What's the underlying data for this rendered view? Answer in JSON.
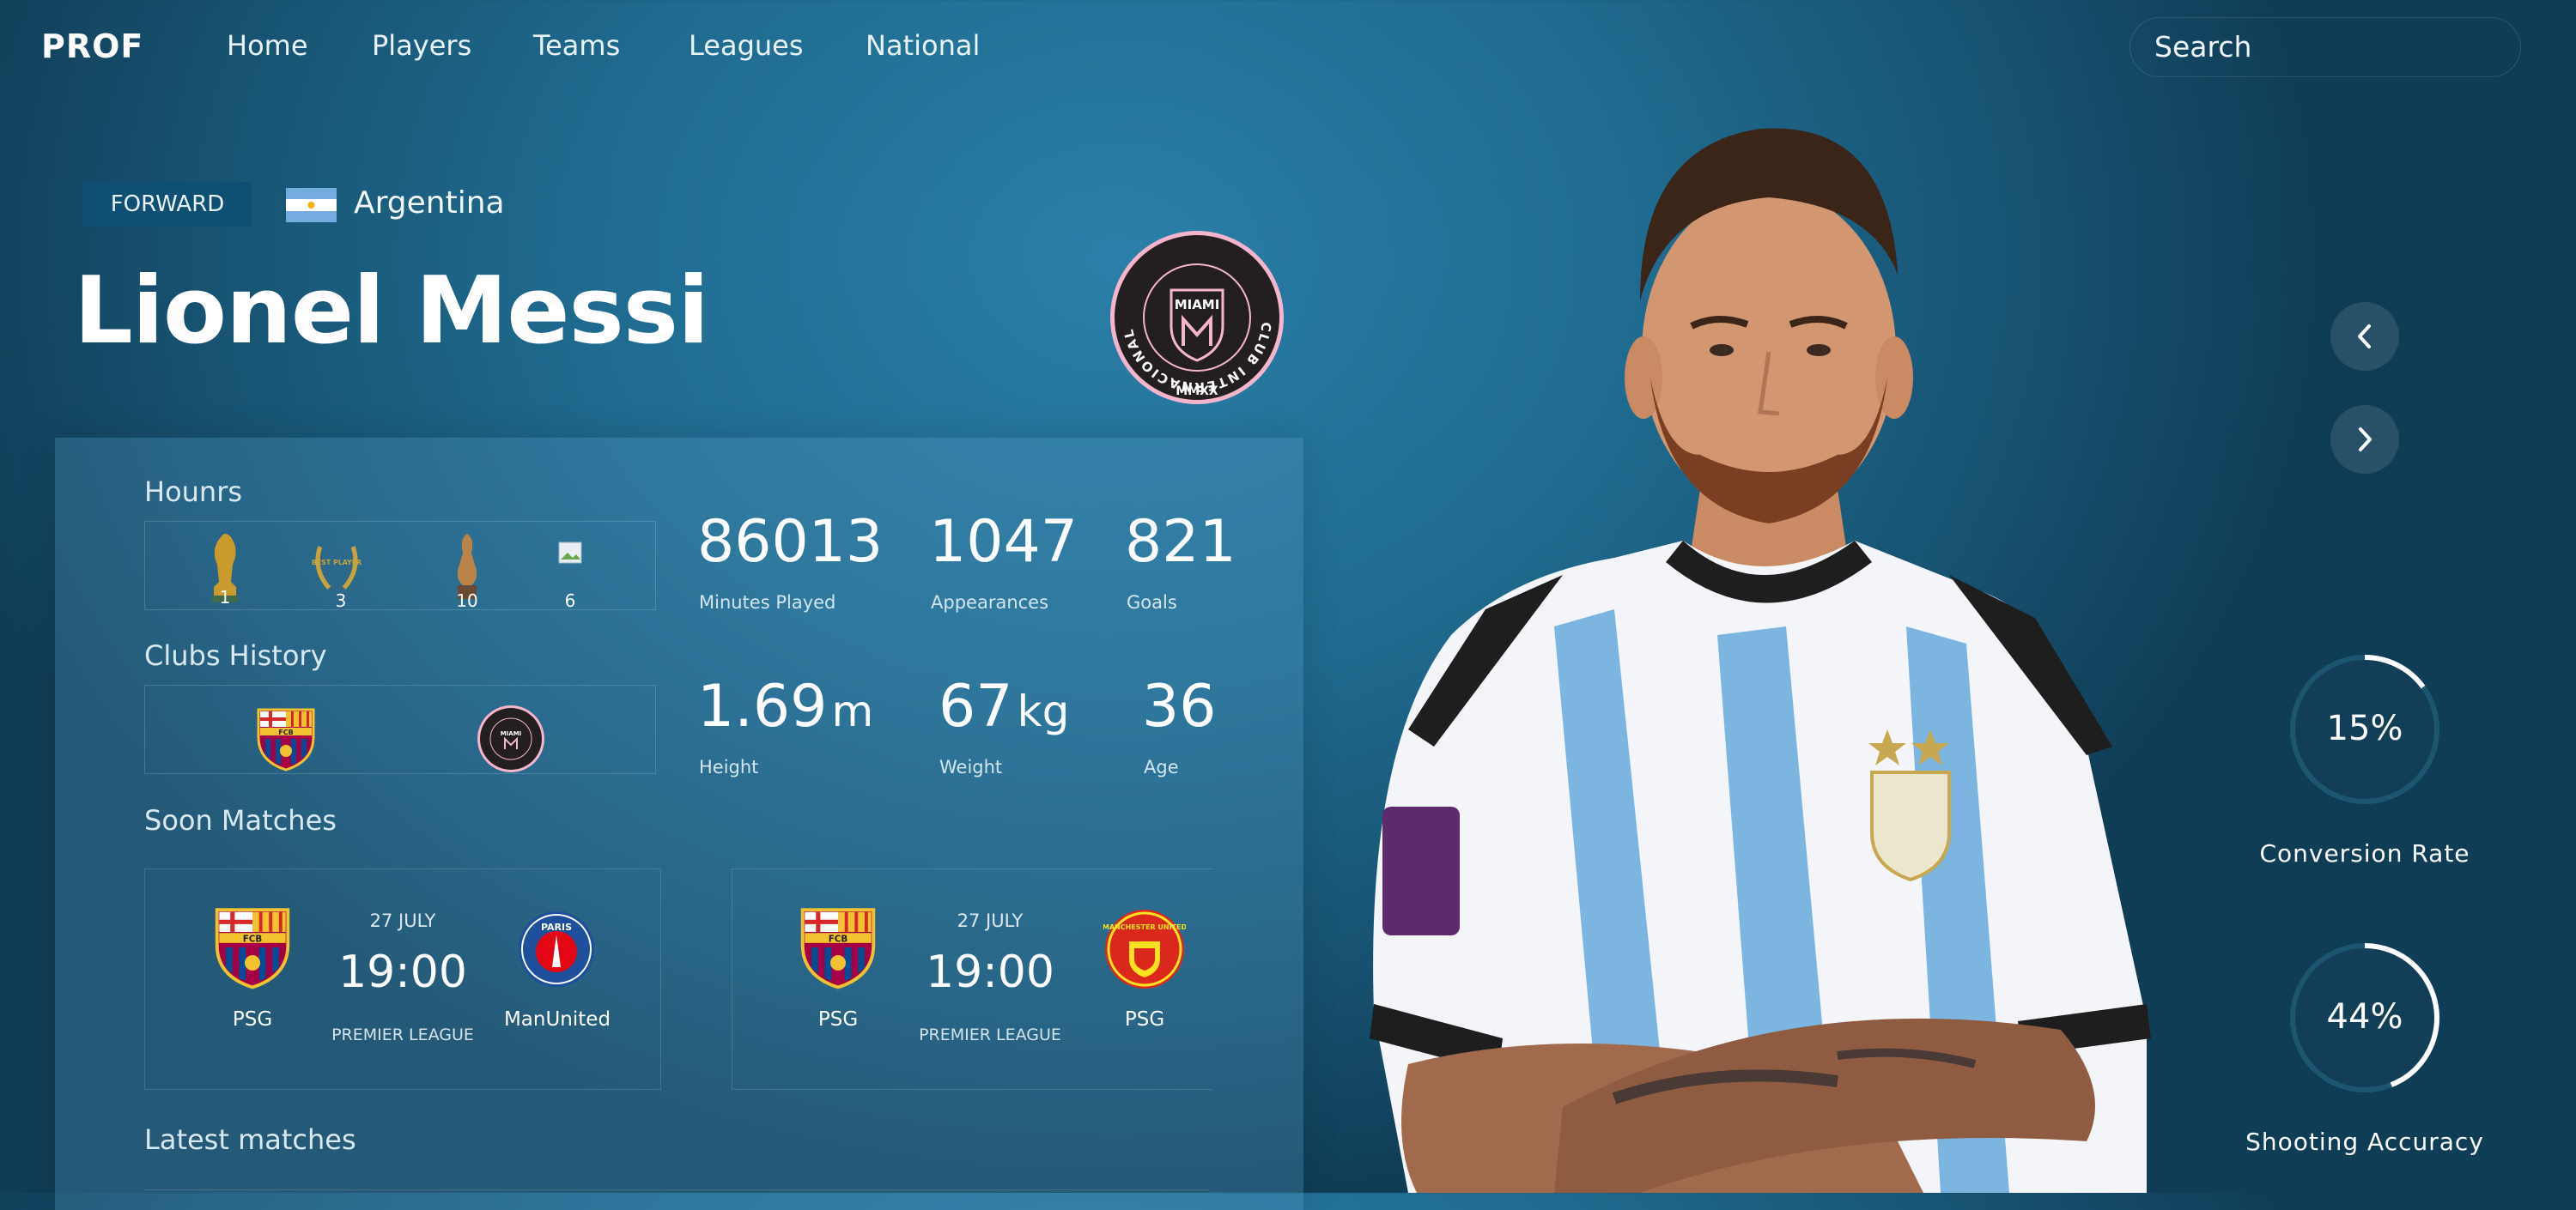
{
  "nav": {
    "logo": "PROF",
    "links": [
      "Home",
      "Players",
      "Teams",
      "Leagues",
      "National"
    ],
    "search_placeholder": "Search"
  },
  "player": {
    "position": "FORWARD",
    "country": "Argentina",
    "name": "Lionel Messi"
  },
  "club_crest": {
    "ring_text": "CLUB INTERNACIONAL DE FUTBOL",
    "name": "MIAMI",
    "year": "MMXX"
  },
  "honors": {
    "title": "Hounrs",
    "items": [
      {
        "icon": "world-cup-trophy-icon",
        "count": "1"
      },
      {
        "icon": "best-player-laurel-icon",
        "label": "BEST PLAYER",
        "count": "3"
      },
      {
        "icon": "champions-trophy-icon",
        "count": "10"
      },
      {
        "icon": "broken-image-icon",
        "count": "6"
      }
    ]
  },
  "clubs": {
    "title": "Clubs History",
    "items": [
      {
        "icon": "fc-barcelona-crest-icon",
        "label": "FCB"
      },
      {
        "icon": "inter-miami-crest-icon",
        "label": "MIAMI"
      }
    ]
  },
  "stats": {
    "minutes": {
      "value": "86013",
      "label": "Minutes Played"
    },
    "appearances": {
      "value": "1047",
      "label": "Appearances"
    },
    "goals": {
      "value": "821",
      "label": "Goals"
    },
    "height": {
      "value": "1.69",
      "unit": "m",
      "label": "Height"
    },
    "weight": {
      "value": "67",
      "unit": "kg",
      "label": "Weight"
    },
    "age": {
      "value": "36",
      "label": "Age"
    }
  },
  "soon_matches": {
    "title": "Soon Matches",
    "items": [
      {
        "home": "PSG",
        "home_crest": "FCB",
        "date": "27 JULY",
        "time": "19:00",
        "league": "PREMIER LEAGUE",
        "away": "ManUnited",
        "away_crest": "PARIS"
      },
      {
        "home": "PSG",
        "home_crest": "FCB",
        "date": "27 JULY",
        "time": "19:00",
        "league": "PREMIER LEAGUE",
        "away": "PSG",
        "away_crest": "MANCHESTER UNITED"
      }
    ]
  },
  "latest_matches": {
    "title": "Latest matches"
  },
  "rings": [
    {
      "value": "15%",
      "fraction": 0.15,
      "label": "Conversion Rate"
    },
    {
      "value": "44%",
      "fraction": 0.44,
      "label": "Shooting Accuracy"
    }
  ],
  "colors": {
    "badge": "#0f4f74",
    "ring_track": "#1c5570",
    "ring_fill": "#ffffff"
  }
}
